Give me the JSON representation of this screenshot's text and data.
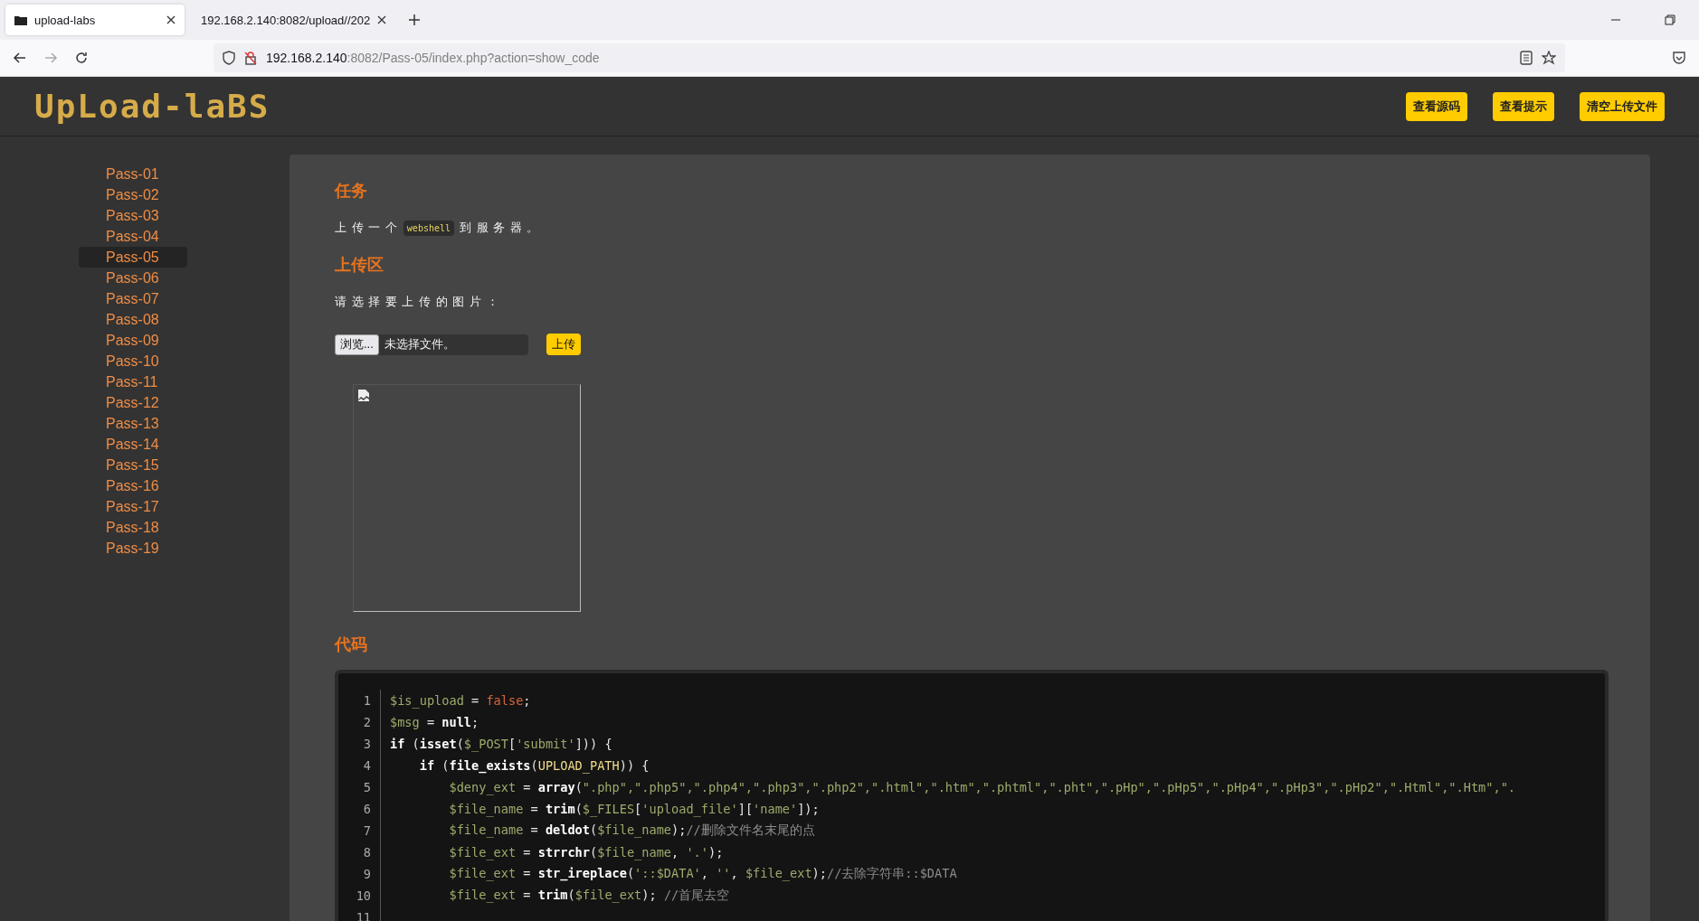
{
  "browser": {
    "tabs": [
      {
        "title": "upload-labs",
        "selected": true
      },
      {
        "title": "192.168.2.140:8082/upload//202",
        "selected": false
      }
    ],
    "url": {
      "host": "192.168.2.140",
      "rest": ":8082/Pass-05/index.php?action=show_code"
    }
  },
  "site": {
    "logo": "UpLoad-laBS",
    "buttons": [
      "查看源码",
      "查看提示",
      "清空上传文件"
    ]
  },
  "sidebar": {
    "items": [
      {
        "label": "Pass-01",
        "selected": false
      },
      {
        "label": "Pass-02",
        "selected": false
      },
      {
        "label": "Pass-03",
        "selected": false
      },
      {
        "label": "Pass-04",
        "selected": false
      },
      {
        "label": "Pass-05",
        "selected": true
      },
      {
        "label": "Pass-06",
        "selected": false
      },
      {
        "label": "Pass-07",
        "selected": false
      },
      {
        "label": "Pass-08",
        "selected": false
      },
      {
        "label": "Pass-09",
        "selected": false
      },
      {
        "label": "Pass-10",
        "selected": false
      },
      {
        "label": "Pass-11",
        "selected": false
      },
      {
        "label": "Pass-12",
        "selected": false
      },
      {
        "label": "Pass-13",
        "selected": false
      },
      {
        "label": "Pass-14",
        "selected": false
      },
      {
        "label": "Pass-15",
        "selected": false
      },
      {
        "label": "Pass-16",
        "selected": false
      },
      {
        "label": "Pass-17",
        "selected": false
      },
      {
        "label": "Pass-18",
        "selected": false
      },
      {
        "label": "Pass-19",
        "selected": false
      }
    ]
  },
  "task": {
    "heading": "任务",
    "before": "上 传 一 个",
    "code": "webshell",
    "after": "到 服 务 器 。"
  },
  "upload": {
    "heading": "上传区",
    "prompt": "请 选 择 要 上 传 的 图 片 ：",
    "browse_button": "浏览...",
    "file_status": "未选择文件。",
    "submit_button": "上传"
  },
  "code": {
    "heading": "代码",
    "lines": [
      {
        "number": "1",
        "tokens": [
          {
            "kind": "var",
            "text": "$is_upload"
          },
          {
            "kind": "plain",
            "text": " = "
          },
          {
            "kind": "lit",
            "text": "false"
          },
          {
            "kind": "plain",
            "text": ";"
          }
        ]
      },
      {
        "number": "2",
        "tokens": [
          {
            "kind": "var",
            "text": "$msg"
          },
          {
            "kind": "plain",
            "text": " = "
          },
          {
            "kind": "fn",
            "text": "null"
          },
          {
            "kind": "plain",
            "text": ";"
          }
        ]
      },
      {
        "number": "3",
        "tokens": [
          {
            "kind": "fn",
            "text": "if"
          },
          {
            "kind": "plain",
            "text": " ("
          },
          {
            "kind": "fn",
            "text": "isset"
          },
          {
            "kind": "plain",
            "text": "("
          },
          {
            "kind": "var",
            "text": "$_POST"
          },
          {
            "kind": "plain",
            "text": "["
          },
          {
            "kind": "str",
            "text": "'submit'"
          },
          {
            "kind": "plain",
            "text": "])) {"
          }
        ],
        "children": [
          {
            "number": "4",
            "tokens": [
              {
                "kind": "fn",
                "text": "if"
              },
              {
                "kind": "plain",
                "text": " ("
              },
              {
                "kind": "fn",
                "text": "file_exists"
              },
              {
                "kind": "plain",
                "text": "("
              },
              {
                "kind": "const",
                "text": "UPLOAD_PATH"
              },
              {
                "kind": "plain",
                "text": ")) {"
              }
            ],
            "children": [
              {
                "number": "5",
                "tokens": [
                  {
                    "kind": "var",
                    "text": "$deny_ext"
                  },
                  {
                    "kind": "plain",
                    "text": " = "
                  },
                  {
                    "kind": "fn",
                    "text": "array"
                  },
                  {
                    "kind": "plain",
                    "text": "("
                  },
                  {
                    "kind": "str",
                    "text": "\".php\",\".php5\",\".php4\",\".php3\",\".php2\",\".html\",\".htm\",\".phtml\",\".pht\",\".pHp\",\".pHp5\",\".pHp4\",\".pHp3\",\".pHp2\",\".Html\",\".Htm\",\"."
                  }
                ]
              },
              {
                "number": "6",
                "tokens": [
                  {
                    "kind": "var",
                    "text": "$file_name"
                  },
                  {
                    "kind": "plain",
                    "text": " = "
                  },
                  {
                    "kind": "fn",
                    "text": "trim"
                  },
                  {
                    "kind": "plain",
                    "text": "("
                  },
                  {
                    "kind": "var",
                    "text": "$_FILES"
                  },
                  {
                    "kind": "plain",
                    "text": "["
                  },
                  {
                    "kind": "str",
                    "text": "'upload_file'"
                  },
                  {
                    "kind": "plain",
                    "text": "]["
                  },
                  {
                    "kind": "str",
                    "text": "'name'"
                  },
                  {
                    "kind": "plain",
                    "text": "]);"
                  }
                ]
              },
              {
                "number": "7",
                "tokens": [
                  {
                    "kind": "var",
                    "text": "$file_name"
                  },
                  {
                    "kind": "plain",
                    "text": " = "
                  },
                  {
                    "kind": "fn",
                    "text": "deldot"
                  },
                  {
                    "kind": "plain",
                    "text": "("
                  },
                  {
                    "kind": "var",
                    "text": "$file_name"
                  },
                  {
                    "kind": "plain",
                    "text": ");"
                  },
                  {
                    "kind": "comment",
                    "text": "//删除文件名末尾的点"
                  }
                ]
              },
              {
                "number": "8",
                "tokens": [
                  {
                    "kind": "var",
                    "text": "$file_ext"
                  },
                  {
                    "kind": "plain",
                    "text": " = "
                  },
                  {
                    "kind": "fn",
                    "text": "strrchr"
                  },
                  {
                    "kind": "plain",
                    "text": "("
                  },
                  {
                    "kind": "var",
                    "text": "$file_name"
                  },
                  {
                    "kind": "plain",
                    "text": ", "
                  },
                  {
                    "kind": "str",
                    "text": "'.'"
                  },
                  {
                    "kind": "plain",
                    "text": ");"
                  }
                ]
              },
              {
                "number": "9",
                "tokens": [
                  {
                    "kind": "var",
                    "text": "$file_ext"
                  },
                  {
                    "kind": "plain",
                    "text": " = "
                  },
                  {
                    "kind": "fn",
                    "text": "str_ireplace"
                  },
                  {
                    "kind": "plain",
                    "text": "("
                  },
                  {
                    "kind": "str",
                    "text": "'::$DATA'"
                  },
                  {
                    "kind": "plain",
                    "text": ", "
                  },
                  {
                    "kind": "str",
                    "text": "''"
                  },
                  {
                    "kind": "plain",
                    "text": ", "
                  },
                  {
                    "kind": "var",
                    "text": "$file_ext"
                  },
                  {
                    "kind": "plain",
                    "text": ");"
                  },
                  {
                    "kind": "comment",
                    "text": "//去除字符串::$DATA"
                  }
                ]
              },
              {
                "number": "10",
                "tokens": [
                  {
                    "kind": "var",
                    "text": "$file_ext"
                  },
                  {
                    "kind": "plain",
                    "text": " = "
                  },
                  {
                    "kind": "fn",
                    "text": "trim"
                  },
                  {
                    "kind": "plain",
                    "text": "("
                  },
                  {
                    "kind": "var",
                    "text": "$file_ext"
                  },
                  {
                    "kind": "plain",
                    "text": "); "
                  },
                  {
                    "kind": "comment",
                    "text": "//首尾去空"
                  }
                ]
              },
              {
                "number": "11"
              }
            ]
          }
        ]
      }
    ]
  }
}
